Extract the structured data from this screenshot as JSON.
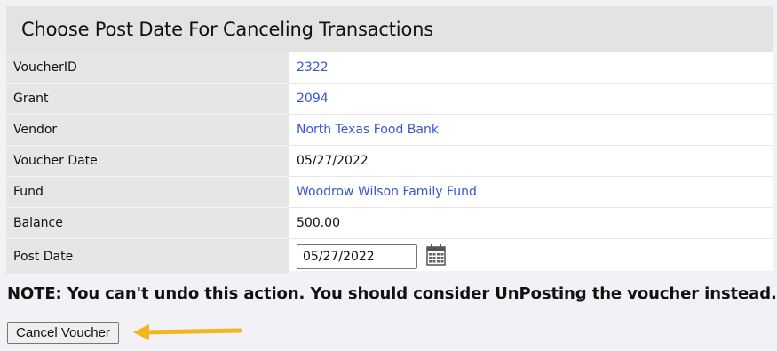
{
  "title": "Choose Post Date For Canceling Transactions",
  "fields": [
    {
      "label": "VoucherID",
      "value": "2322",
      "link": true
    },
    {
      "label": "Grant",
      "value": "2094",
      "link": true
    },
    {
      "label": "Vendor",
      "value": "North Texas Food Bank",
      "link": true
    },
    {
      "label": "Voucher Date",
      "value": "05/27/2022",
      "link": false
    },
    {
      "label": "Fund",
      "value": "Woodrow Wilson Family Fund",
      "link": true
    },
    {
      "label": "Balance",
      "value": "500.00",
      "link": false
    }
  ],
  "post_date": {
    "label": "Post Date",
    "value": "05/27/2022",
    "icon": "calendar-icon"
  },
  "note": "NOTE: You can't undo this action. You should consider UnPosting the voucher instead.",
  "cancel_button": "Cancel Voucher",
  "colors": {
    "link": "#3a55d4",
    "arrow": "#f2b51a",
    "header_bg": "#e3e3e3"
  }
}
